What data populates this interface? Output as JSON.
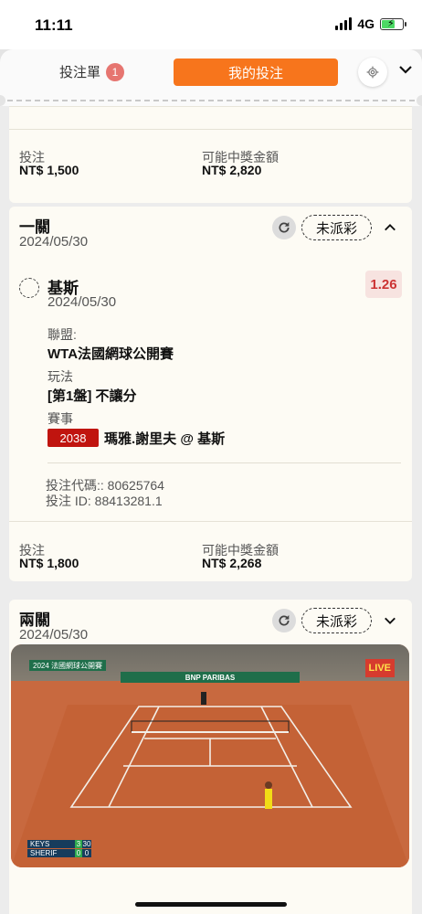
{
  "status_bar": {
    "time": "11:11",
    "network": "4G"
  },
  "header": {
    "bet_slip_label": "投注單",
    "bet_slip_count": "1",
    "my_bets_label": "我的投注",
    "accent_color": "#f7751c"
  },
  "card1": {
    "stake_label": "投注",
    "stake_value": "NT$ 1,500",
    "payout_label": "可能中獎金額",
    "payout_value": "NT$ 2,820"
  },
  "card2": {
    "title": "一關",
    "date": "2024/05/30",
    "status": "未派彩",
    "selection": {
      "name": "基斯",
      "date": "2024/05/30",
      "odds": "1.26",
      "league_label": "聯盟:",
      "league_value": "WTA法國網球公開賽",
      "market_label": "玩法",
      "market_value": "[第1盤] 不讓分",
      "event_label": "賽事",
      "match_id": "2038",
      "match_name": "瑪雅.謝里夫 @ 基斯"
    },
    "bet_code": "投注代碼:: 80625764",
    "bet_id": "投注 ID: 88413281.1",
    "stake_label": "投注",
    "stake_value": "NT$ 1,800",
    "payout_label": "可能中獎金額",
    "payout_value": "NT$ 2,268"
  },
  "card3": {
    "title": "兩關",
    "date": "2024/05/30",
    "status": "未派彩"
  },
  "video": {
    "overlay_title": "2024 法國網球公開賽",
    "banner": "BNP PARIBAS",
    "score": [
      {
        "name": "KEYS",
        "set": "3",
        "game": "30"
      },
      {
        "name": "SHERIF",
        "set": "0",
        "game": "0"
      }
    ],
    "live_logo": "LIVE"
  }
}
